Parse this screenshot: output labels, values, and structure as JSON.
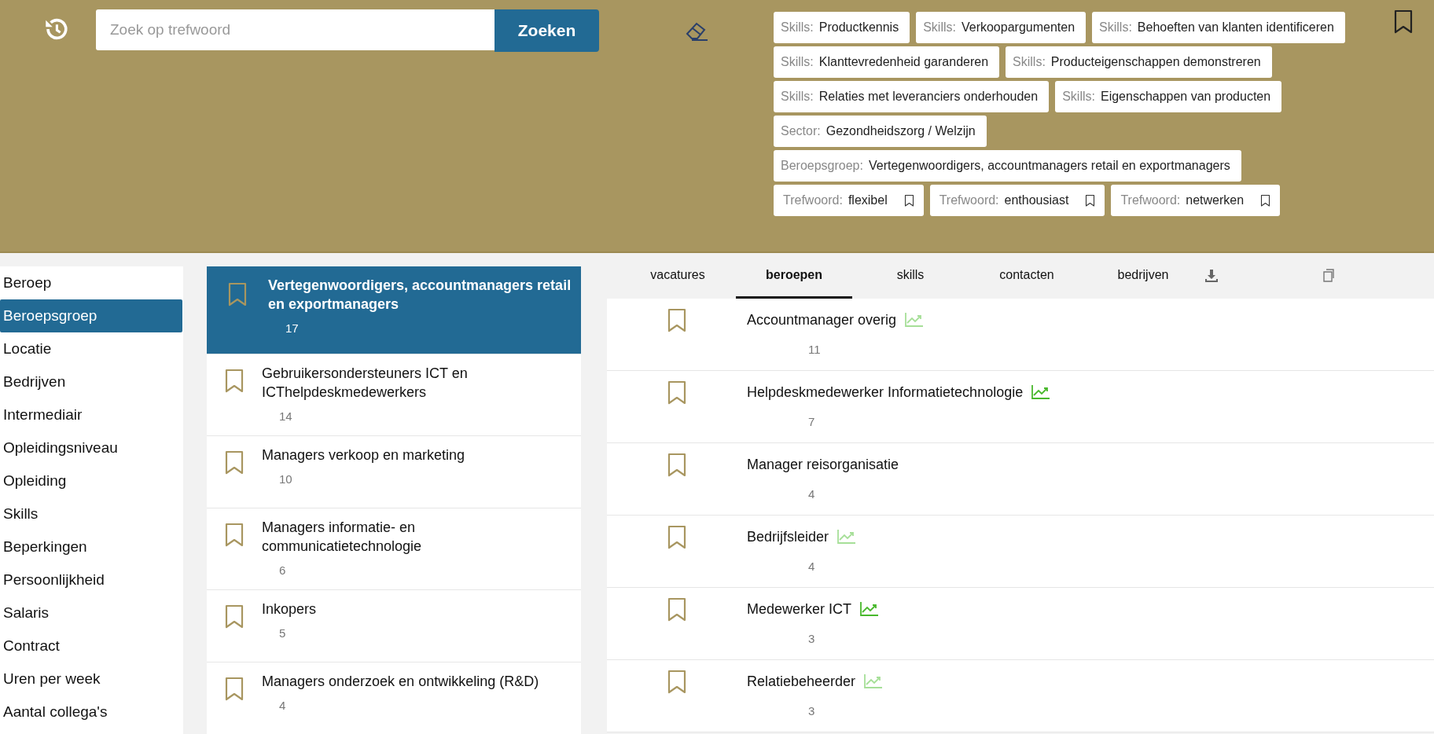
{
  "search": {
    "placeholder": "Zoek op trefwoord",
    "button": "Zoeken"
  },
  "filters": [
    {
      "kind": "plain",
      "label": "Skills:",
      "value": "Productkennis"
    },
    {
      "kind": "plain",
      "label": "Skills:",
      "value": "Verkoopargumenten"
    },
    {
      "kind": "plain",
      "label": "Skills:",
      "value": "Behoeften van klanten identificeren"
    },
    {
      "kind": "plain",
      "label": "Skills:",
      "value": "Klanttevredenheid garanderen"
    },
    {
      "kind": "plain",
      "label": "Skills:",
      "value": "Producteigenschappen demonstreren"
    },
    {
      "kind": "plain",
      "label": "Skills:",
      "value": "Relaties met leveranciers onderhouden"
    },
    {
      "kind": "plain",
      "label": "Skills:",
      "value": "Eigenschappen van producten"
    },
    {
      "kind": "plain",
      "label": "Sector:",
      "value": "Gezondheidszorg / Welzijn"
    },
    {
      "kind": "plain",
      "label": "Beroepsgroep:",
      "value": "Vertegenwoordigers, accountmanagers retail en exportmanagers"
    },
    {
      "kind": "keyword",
      "label": "Trefwoord:",
      "value": "flexibel"
    },
    {
      "kind": "keyword",
      "label": "Trefwoord:",
      "value": "enthousiast"
    },
    {
      "kind": "keyword",
      "label": "Trefwoord:",
      "value": "netwerken"
    }
  ],
  "sidebar": {
    "items": [
      {
        "label": "Beroep",
        "selected": false
      },
      {
        "label": "Beroepsgroep",
        "selected": true
      },
      {
        "label": "Locatie",
        "selected": false
      },
      {
        "label": "Bedrijven",
        "selected": false
      },
      {
        "label": "Intermediair",
        "selected": false
      },
      {
        "label": "Opleidingsniveau",
        "selected": false
      },
      {
        "label": "Opleiding",
        "selected": false
      },
      {
        "label": "Skills",
        "selected": false
      },
      {
        "label": "Beperkingen",
        "selected": false
      },
      {
        "label": "Persoonlijkheid",
        "selected": false
      },
      {
        "label": "Salaris",
        "selected": false
      },
      {
        "label": "Contract",
        "selected": false
      },
      {
        "label": "Uren per week",
        "selected": false
      },
      {
        "label": "Aantal collega's",
        "selected": false
      }
    ]
  },
  "groups": [
    {
      "title": "Vertegenwoordigers, accountmanagers retail en exportmanagers",
      "count": "17",
      "selected": true
    },
    {
      "title": "Gebruikersondersteuners ICT en ICThelpdeskmedewerkers",
      "count": "14",
      "selected": false
    },
    {
      "title": "Managers verkoop en marketing",
      "count": "10",
      "selected": false
    },
    {
      "title": "Managers informatie- en communicatietechnologie",
      "count": "6",
      "selected": false
    },
    {
      "title": "Inkopers",
      "count": "5",
      "selected": false
    },
    {
      "title": "Managers onderzoek en ontwikkeling (R&D)",
      "count": "4",
      "selected": false
    }
  ],
  "tabs": [
    {
      "label": "vacatures",
      "selected": false
    },
    {
      "label": "beroepen",
      "selected": true
    },
    {
      "label": "skills",
      "selected": false
    },
    {
      "label": "contacten",
      "selected": false
    },
    {
      "label": "bedrijven",
      "selected": false
    }
  ],
  "occupations": [
    {
      "title": "Accountmanager overig",
      "count": "11",
      "color": "#a6df98"
    },
    {
      "title": "Helpdeskmedewerker Informatietechnologie",
      "count": "7",
      "color": "#48b82c"
    },
    {
      "title": "Manager reisorganisatie",
      "count": "4"
    },
    {
      "title": "Bedrijfsleider",
      "count": "4",
      "color": "#a6df98"
    },
    {
      "title": "Medewerker ICT",
      "count": "3",
      "color": "#48b82c"
    },
    {
      "title": "Relatiebeheerder",
      "count": "3",
      "color": "#a6df98"
    }
  ]
}
